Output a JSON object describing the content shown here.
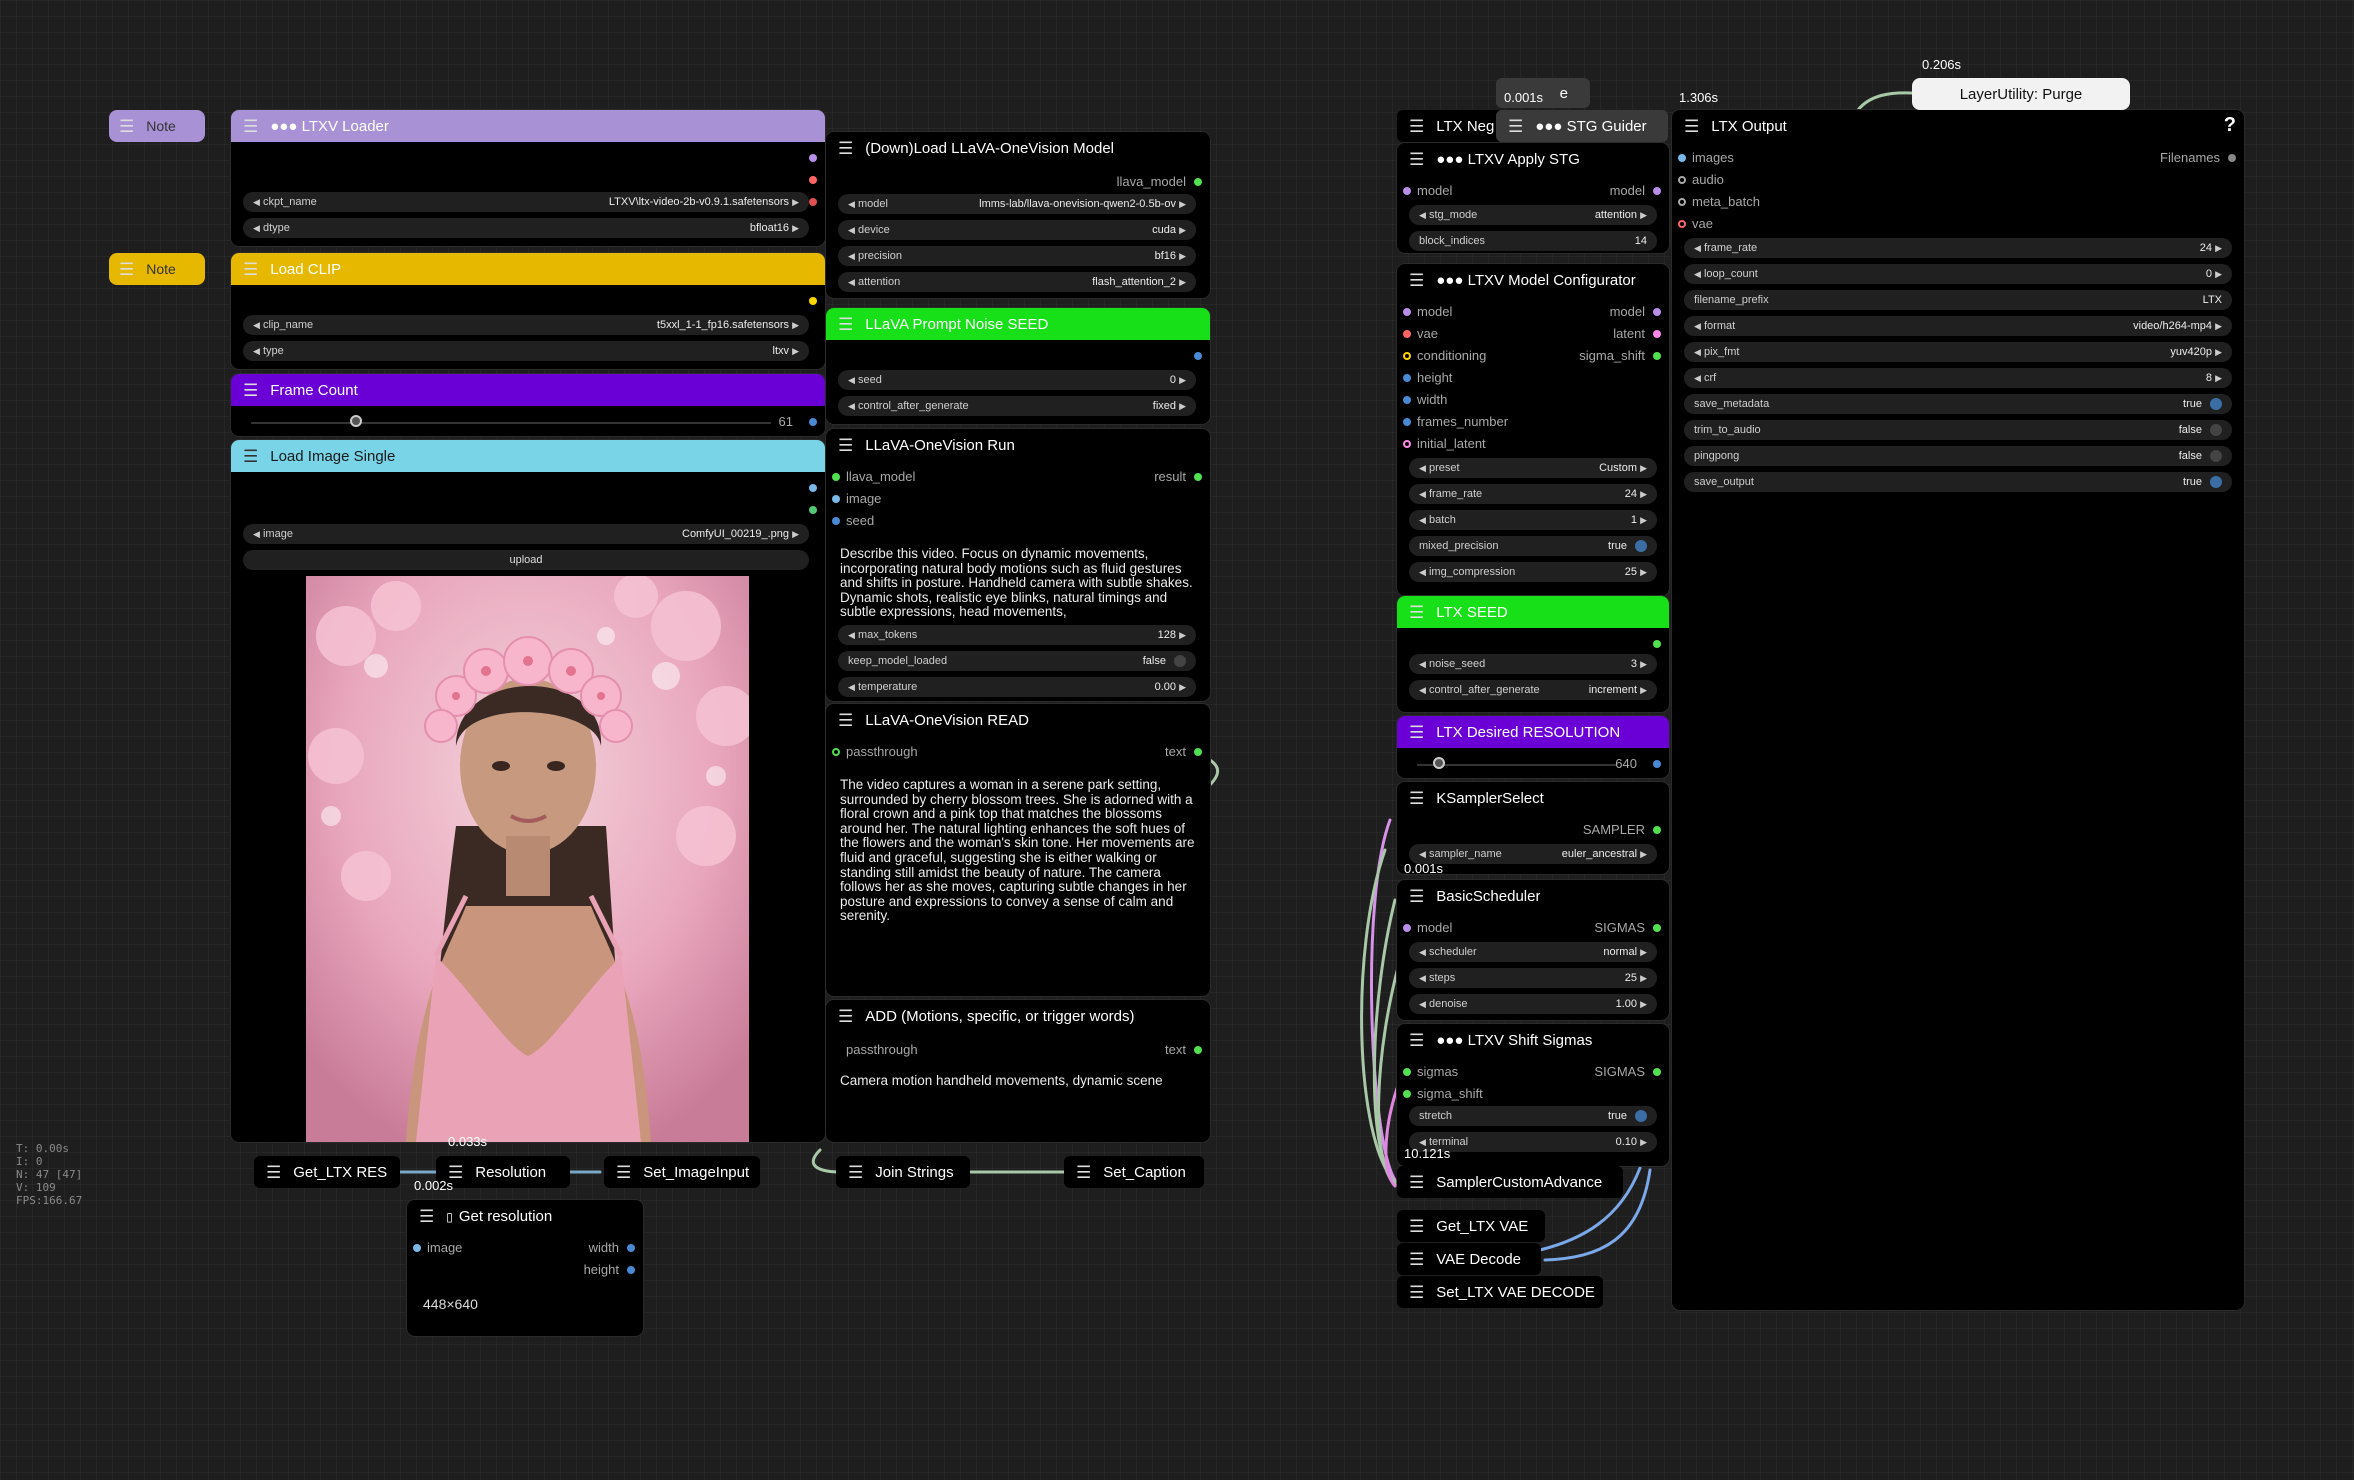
{
  "stats": {
    "lines": [
      "T: 0.00s",
      "I: 0",
      "N: 47 [47]",
      "V: 109",
      "FPS:166.67"
    ]
  },
  "notes": [
    {
      "label": "Note"
    },
    {
      "label": "Note"
    }
  ],
  "ltxv_loader": {
    "title": "●●● LTXV Loader",
    "ckpt_label": "ckpt_name",
    "ckpt_value": "LTXV\\ltx-video-2b-v0.9.1.safetensors",
    "dtype_label": "dtype",
    "dtype_value": "bfloat16"
  },
  "load_clip": {
    "title": "Load CLIP",
    "clip_label": "clip_name",
    "clip_value": "t5xxl_1-1_fp16.safetensors",
    "type_label": "type",
    "type_value": "ltxv"
  },
  "frame_count": {
    "title": "Frame Count",
    "value": "61"
  },
  "load_image": {
    "title": "Load Image Single",
    "image_label": "image",
    "image_value": "ComfyUI_00219_.png",
    "upload": "upload"
  },
  "llava_load": {
    "title": "(Down)Load LLaVA-OneVision Model",
    "out": "llava_model",
    "rows": [
      {
        "l": "model",
        "v": "lmms-lab/llava-onevision-qwen2-0.5b-ov"
      },
      {
        "l": "device",
        "v": "cuda"
      },
      {
        "l": "precision",
        "v": "bf16"
      },
      {
        "l": "attention",
        "v": "flash_attention_2"
      }
    ]
  },
  "llava_seed": {
    "title": "LLaVA Prompt Noise SEED",
    "seed_label": "seed",
    "seed_value": "0",
    "cag_label": "control_after_generate",
    "cag_value": "fixed"
  },
  "llava_run": {
    "title": "LLaVA-OneVision Run",
    "in1": "llava_model",
    "in2": "image",
    "in3": "seed",
    "out": "result",
    "prompt": "Describe this video. Focus on dynamic movements, incorporating natural body motions such as fluid gestures and shifts in posture. Handheld camera with subtle shakes. Dynamic shots, realistic eye blinks, natural timings and subtle expressions, head movements,",
    "max_tokens_label": "max_tokens",
    "max_tokens_value": "128",
    "keep_label": "keep_model_loaded",
    "keep_value": "false",
    "temp_label": "temperature",
    "temp_value": "0.00"
  },
  "llava_read": {
    "title": "LLaVA-OneVision READ",
    "in": "passthrough",
    "out": "text",
    "text": "The video captures a woman in a serene park setting, surrounded by cherry blossom trees. She is adorned with a floral crown and a pink top that matches the blossoms around her. The natural lighting enhances the soft hues of the flowers and the woman's skin tone. Her movements are fluid and graceful, suggesting she is either walking or standing still amidst the beauty of nature. The camera follows her as she moves, capturing subtle changes in her posture and expressions to convey a sense of calm and serenity."
  },
  "add_words": {
    "title": "ADD (Motions, specific, or trigger words)",
    "in": "passthrough",
    "out": "text",
    "text": "Camera motion handheld movements, dynamic scene"
  },
  "bottom_nodes": {
    "get_ltx_res": "Get_LTX RES",
    "resolution": "Resolution",
    "set_image": "Set_ImageInput",
    "join": "Join Strings",
    "set_caption": "Set_Caption"
  },
  "get_resolution": {
    "title": "Get resolution",
    "in": "image",
    "out1": "width",
    "out2": "height",
    "value": "448×640"
  },
  "ltx_neg": {
    "title": "LTX Neg"
  },
  "stg_guider": {
    "title": "●●● STG Guider",
    "collapsed_suffix": "e"
  },
  "apply_stg": {
    "title": "●●● LTXV Apply STG",
    "in": "model",
    "out": "model",
    "mode_label": "stg_mode",
    "mode_value": "attention",
    "block_label": "block_indices",
    "block_value": "14"
  },
  "configurator": {
    "title": "●●● LTXV Model Configurator",
    "inputs": [
      "model",
      "vae",
      "conditioning",
      "height",
      "width",
      "frames_number",
      "initial_latent"
    ],
    "outputs": [
      "model",
      "latent",
      "sigma_shift"
    ],
    "rows": [
      {
        "l": "preset",
        "v": "Custom"
      },
      {
        "l": "frame_rate",
        "v": "24"
      },
      {
        "l": "batch",
        "v": "1"
      },
      {
        "l": "mixed_precision",
        "v": "true"
      },
      {
        "l": "img_compression",
        "v": "25"
      }
    ]
  },
  "ltx_seed": {
    "title": "LTX SEED",
    "noise_label": "noise_seed",
    "noise_value": "3",
    "cag_label": "control_after_generate",
    "cag_value": "increment"
  },
  "desired_res": {
    "title": "LTX Desired RESOLUTION",
    "value": "640"
  },
  "ksampler_select": {
    "title": "KSamplerSelect",
    "out": "SAMPLER",
    "sampler_label": "sampler_name",
    "sampler_value": "euler_ancestral"
  },
  "basic_scheduler": {
    "title": "BasicScheduler",
    "in": "model",
    "out": "SIGMAS",
    "rows": [
      {
        "l": "scheduler",
        "v": "normal"
      },
      {
        "l": "steps",
        "v": "25"
      },
      {
        "l": "denoise",
        "v": "1.00"
      }
    ]
  },
  "shift_sigmas": {
    "title": "●●● LTXV Shift Sigmas",
    "in1": "sigmas",
    "in2": "sigma_shift",
    "out": "SIGMAS",
    "stretch_label": "stretch",
    "stretch_value": "true",
    "terminal_label": "terminal",
    "terminal_value": "0.10"
  },
  "sampler_advanced": {
    "title": "SamplerCustomAdvance"
  },
  "vae_nodes": {
    "get_vae": "Get_LTX VAE",
    "decode": "VAE Decode",
    "set_decode": "Set_LTX VAE DECODE"
  },
  "ltx_output": {
    "title": "LTX Output",
    "help": "?",
    "inputs": [
      "images",
      "audio",
      "meta_batch",
      "vae"
    ],
    "out": "Filenames",
    "rows": [
      {
        "l": "frame_rate",
        "v": "24"
      },
      {
        "l": "loop_count",
        "v": "0"
      },
      {
        "l": "filename_prefix",
        "v": "LTX"
      },
      {
        "l": "format",
        "v": "video/h264-mp4"
      },
      {
        "l": "pix_fmt",
        "v": "yuv420p"
      },
      {
        "l": "crf",
        "v": "8"
      }
    ],
    "bools": [
      {
        "l": "save_metadata",
        "v": "true"
      },
      {
        "l": "trim_to_audio",
        "v": "false"
      },
      {
        "l": "pingpong",
        "v": "false"
      },
      {
        "l": "save_output",
        "v": "true"
      }
    ]
  },
  "purge": {
    "title": "LayerUtility: Purge"
  },
  "timings": {
    "t1": "0.033s",
    "t2": "0.002s",
    "t3": "0.001s",
    "t4": "1.306s",
    "t5": "0.206s",
    "t6": "0.001s",
    "t7": "10.121s"
  },
  "colors": {
    "loader": "#a891d4",
    "clip": "#e6b800",
    "frame": "#6a00d6",
    "image": "#79d4e8",
    "seed": "#18e018",
    "res": "#6a00d6"
  }
}
